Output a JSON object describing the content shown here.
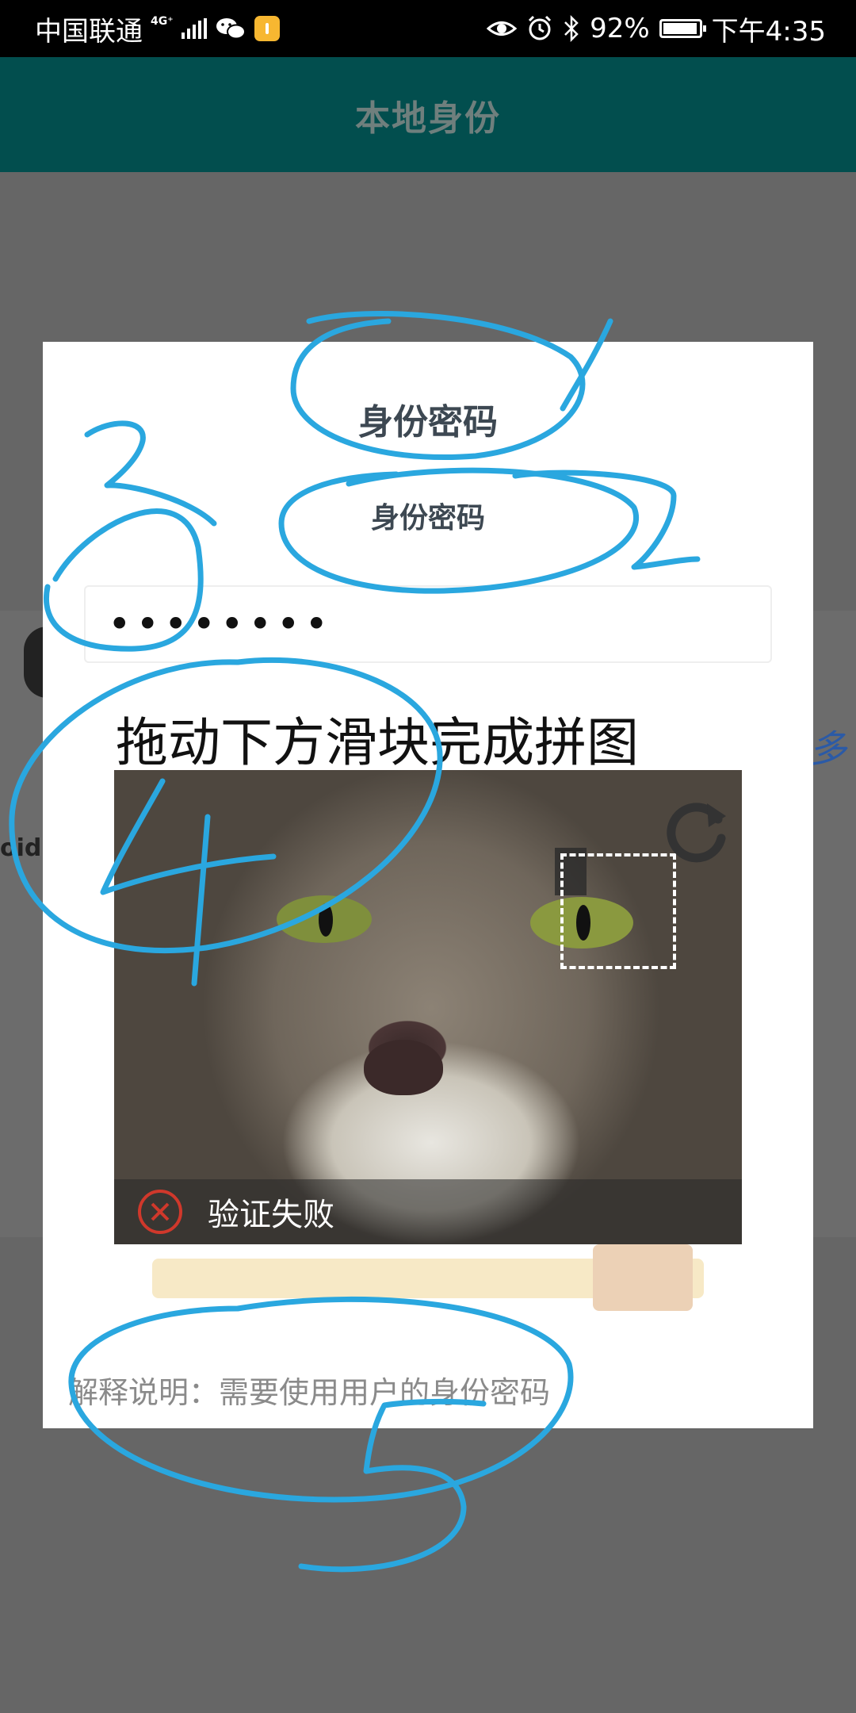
{
  "status_bar": {
    "carrier": "中国联通",
    "network": "4G⁺",
    "battery": "92%",
    "time": "下午4:35"
  },
  "header": {
    "title": "本地身份"
  },
  "background": {
    "fragment_left": "oid:",
    "fragment_right": "多"
  },
  "dialog": {
    "title": "身份密码",
    "field_label": "身份密码",
    "password_value": "••••••••",
    "captcha": {
      "instruction": "拖动下方滑块完成拼图",
      "status_text": "验证失败",
      "slider_position": 0.84
    },
    "note": "解释说明：需要使用用户的身份密码"
  },
  "annotations": {
    "color": "#2aa7df",
    "numbers": [
      "1",
      "2",
      "3",
      "4",
      "5"
    ]
  }
}
